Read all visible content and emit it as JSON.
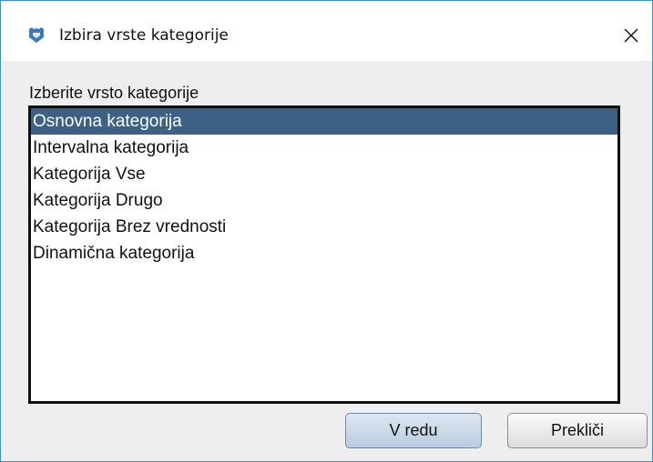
{
  "window": {
    "title": "Izbira vrste kategorije",
    "icon": "app-shield-icon",
    "close_icon": "close-icon",
    "accent_color": "#3c8fd6"
  },
  "dialog": {
    "prompt": "Izberite vrsto kategorije",
    "selected_index": 0,
    "selection_color": "#3d6185",
    "items": [
      {
        "label": "Osnovna kategorija"
      },
      {
        "label": "Intervalna kategorija"
      },
      {
        "label": "Kategorija Vse"
      },
      {
        "label": "Kategorija Drugo"
      },
      {
        "label": "Kategorija Brez vrednosti"
      },
      {
        "label": "Dinamična kategorija"
      }
    ]
  },
  "buttons": {
    "ok_label": "V redu",
    "cancel_label": "Prekliči"
  }
}
